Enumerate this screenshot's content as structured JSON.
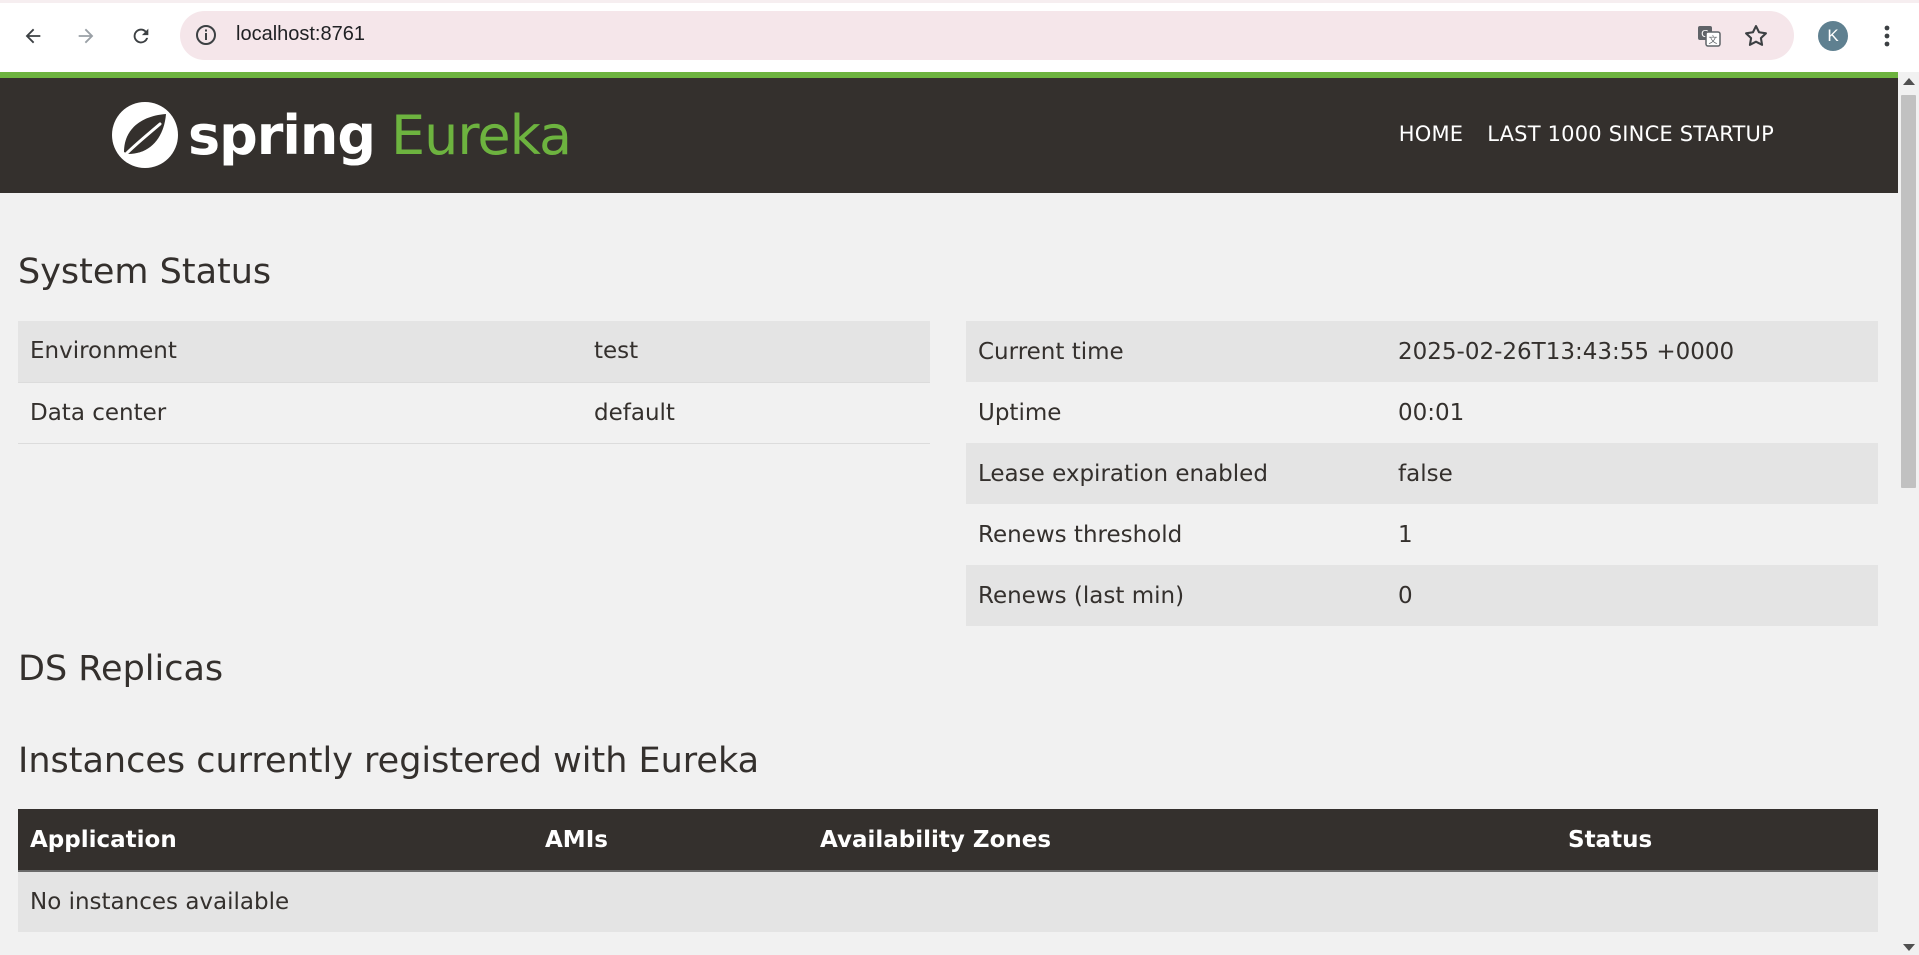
{
  "browser": {
    "url": "localhost:8761",
    "profile_initial": "K"
  },
  "header": {
    "logo_spring": "spring",
    "logo_eureka": "Eureka",
    "nav": [
      "HOME",
      "LAST 1000 SINCE STARTUP"
    ]
  },
  "system_status": {
    "title": "System Status",
    "left": [
      {
        "key": "Environment",
        "value": "test"
      },
      {
        "key": "Data center",
        "value": "default"
      }
    ],
    "right": [
      {
        "key": "Current time",
        "value": "2025-02-26T13:43:55 +0000"
      },
      {
        "key": "Uptime",
        "value": "00:01"
      },
      {
        "key": "Lease expiration enabled",
        "value": "false"
      },
      {
        "key": "Renews threshold",
        "value": "1"
      },
      {
        "key": "Renews (last min)",
        "value": "0"
      }
    ]
  },
  "ds_replicas": {
    "title": "DS Replicas"
  },
  "instances": {
    "title": "Instances currently registered with Eureka",
    "columns": [
      "Application",
      "AMIs",
      "Availability Zones",
      "Status"
    ],
    "empty_message": "No instances available"
  },
  "colors": {
    "header_bg": "#34302d",
    "accent_green": "#6db33f",
    "page_bg": "#f1f1f1",
    "row_stripe": "#e4e4e4"
  },
  "icons": {
    "back": "arrow-left-icon",
    "forward": "arrow-right-icon",
    "reload": "reload-icon",
    "site_info": "info-icon",
    "translate": "translate-icon",
    "bookmark": "star-icon",
    "menu": "kebab-menu-icon",
    "logo": "spring-leaf-icon"
  }
}
